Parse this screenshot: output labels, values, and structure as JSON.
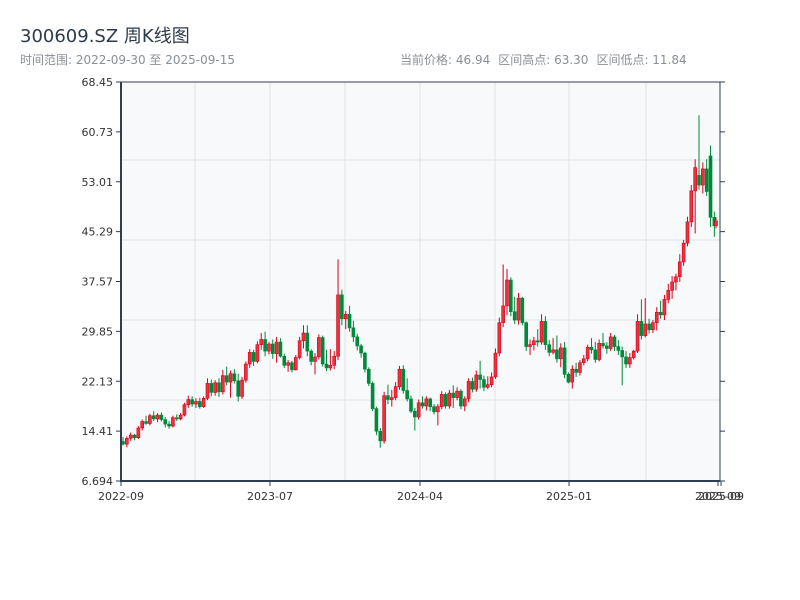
{
  "header": {
    "title": "300609.SZ 周K线图",
    "range_label": "时间范围: 2022-09-30 至 2025-09-15",
    "current_price": "当前价格: 46.94",
    "range_high": "区间高点: 63.30",
    "range_low": "区间低点: 11.84"
  },
  "colors": {
    "up": "#d9001b",
    "down": "#00893a",
    "axis": "#2c3e50",
    "grid": "#e1e5ea",
    "plot_bg": "#f7f9fb"
  },
  "chart_data": {
    "type": "candlestick",
    "title": "300609.SZ 周K线图",
    "ylim": [
      6.694,
      68.45
    ],
    "y_ticks": [
      "68.45",
      "60.73",
      "53.01",
      "45.29",
      "37.57",
      "29.85",
      "22.13",
      "14.41",
      "6.694"
    ],
    "x_ticks": [
      "2022-09",
      "2023-07",
      "2024-04",
      "2025-01",
      "2025-09",
      "2025-09"
    ],
    "x_range": [
      "2022-09-30",
      "2025-09-15"
    ],
    "grid": true,
    "up_color_meaning": "red = up, green = down",
    "columns": [
      "date",
      "open",
      "high",
      "low",
      "close"
    ],
    "candles": [
      [
        "2022-09-30",
        12.8,
        13.5,
        12.2,
        12.4
      ],
      [
        "2022-10-07",
        12.4,
        13.6,
        11.9,
        13.3
      ],
      [
        "2022-10-14",
        13.3,
        14.2,
        12.9,
        13.8
      ],
      [
        "2022-10-21",
        13.8,
        14.0,
        13.0,
        13.4
      ],
      [
        "2022-10-28",
        13.4,
        15.2,
        13.2,
        14.9
      ],
      [
        "2022-11-04",
        14.9,
        16.2,
        14.5,
        15.9
      ],
      [
        "2022-11-11",
        15.9,
        16.8,
        15.4,
        15.6
      ],
      [
        "2022-11-18",
        15.6,
        17.1,
        15.3,
        16.8
      ],
      [
        "2022-11-25",
        16.8,
        17.5,
        16.0,
        16.3
      ],
      [
        "2022-12-02",
        16.3,
        17.2,
        15.8,
        16.9
      ],
      [
        "2022-12-09",
        16.9,
        17.3,
        15.9,
        16.2
      ],
      [
        "2022-12-16",
        16.2,
        16.6,
        15.0,
        15.5
      ],
      [
        "2022-12-23",
        15.5,
        16.0,
        14.8,
        15.2
      ],
      [
        "2022-12-30",
        15.2,
        16.8,
        15.0,
        16.5
      ],
      [
        "2023-01-06",
        16.5,
        17.0,
        16.0,
        16.3
      ],
      [
        "2023-01-13",
        16.3,
        17.2,
        16.1,
        16.9
      ],
      [
        "2023-01-20",
        16.9,
        18.8,
        16.7,
        18.5
      ],
      [
        "2023-01-27",
        18.5,
        19.9,
        18.0,
        19.3
      ],
      [
        "2023-02-03",
        19.3,
        19.8,
        18.2,
        18.6
      ],
      [
        "2023-02-10",
        18.6,
        19.5,
        18.0,
        19.0
      ],
      [
        "2023-02-17",
        19.0,
        19.6,
        17.9,
        18.2
      ],
      [
        "2023-02-24",
        18.2,
        19.8,
        18.0,
        19.5
      ],
      [
        "2023-03-03",
        19.5,
        22.6,
        19.2,
        21.8
      ],
      [
        "2023-03-10",
        21.8,
        22.4,
        19.8,
        20.4
      ],
      [
        "2023-03-17",
        20.4,
        22.3,
        19.9,
        21.9
      ],
      [
        "2023-03-24",
        21.9,
        22.6,
        19.7,
        20.5
      ],
      [
        "2023-03-31",
        20.5,
        23.9,
        20.1,
        23.0
      ],
      [
        "2023-04-07",
        23.0,
        24.4,
        21.5,
        22.0
      ],
      [
        "2023-04-14",
        22.0,
        23.8,
        19.6,
        23.3
      ],
      [
        "2023-04-21",
        23.3,
        24.0,
        21.8,
        22.2
      ],
      [
        "2023-04-28",
        22.2,
        23.3,
        19.0,
        19.8
      ],
      [
        "2023-05-05",
        19.8,
        22.8,
        19.4,
        22.3
      ],
      [
        "2023-05-12",
        22.3,
        25.2,
        21.9,
        24.8
      ],
      [
        "2023-05-19",
        24.8,
        27.1,
        24.2,
        26.6
      ],
      [
        "2023-05-26",
        26.6,
        27.0,
        24.5,
        25.2
      ],
      [
        "2023-06-02",
        25.2,
        28.3,
        24.9,
        27.8
      ],
      [
        "2023-06-09",
        27.8,
        29.6,
        27.0,
        28.6
      ],
      [
        "2023-06-16",
        28.6,
        29.8,
        26.0,
        26.8
      ],
      [
        "2023-06-23",
        26.8,
        28.2,
        26.3,
        27.9
      ],
      [
        "2023-06-30",
        27.9,
        28.6,
        25.6,
        26.4
      ],
      [
        "2023-07-07",
        26.4,
        29.0,
        25.0,
        28.2
      ],
      [
        "2023-07-14",
        28.2,
        28.8,
        25.8,
        26.0
      ],
      [
        "2023-07-21",
        26.0,
        26.4,
        24.2,
        24.6
      ],
      [
        "2023-07-28",
        24.6,
        25.4,
        23.6,
        25.0
      ],
      [
        "2023-08-04",
        25.0,
        25.3,
        23.5,
        23.9
      ],
      [
        "2023-08-11",
        23.9,
        26.2,
        23.8,
        25.8
      ],
      [
        "2023-08-18",
        25.8,
        29.0,
        25.5,
        28.4
      ],
      [
        "2023-08-25",
        28.4,
        30.8,
        27.2,
        29.6
      ],
      [
        "2023-09-01",
        29.6,
        30.8,
        26.0,
        26.8
      ],
      [
        "2023-09-08",
        26.8,
        27.1,
        24.6,
        25.2
      ],
      [
        "2023-09-15",
        25.2,
        26.5,
        23.2,
        25.9
      ],
      [
        "2023-09-22",
        25.9,
        29.4,
        25.5,
        28.9
      ],
      [
        "2023-09-29",
        28.9,
        29.2,
        24.4,
        24.8
      ],
      [
        "2023-10-06",
        24.8,
        27.0,
        23.7,
        24.2
      ],
      [
        "2023-10-13",
        24.2,
        27.1,
        23.8,
        24.6
      ],
      [
        "2023-10-20",
        24.6,
        26.8,
        24.0,
        26.0
      ],
      [
        "2023-10-27",
        26.0,
        41.0,
        25.4,
        35.5
      ],
      [
        "2023-11-03",
        35.5,
        36.3,
        30.8,
        31.8
      ],
      [
        "2023-11-10",
        31.8,
        33.0,
        30.2,
        32.5
      ],
      [
        "2023-11-17",
        32.5,
        33.8,
        29.8,
        30.4
      ],
      [
        "2023-11-24",
        30.4,
        31.5,
        28.2,
        29.0
      ],
      [
        "2023-12-01",
        29.0,
        29.5,
        26.9,
        27.6
      ],
      [
        "2023-12-08",
        27.6,
        27.9,
        25.8,
        26.5
      ],
      [
        "2023-12-15",
        26.5,
        26.7,
        23.5,
        24.0
      ],
      [
        "2023-12-22",
        24.0,
        24.3,
        21.4,
        21.8
      ],
      [
        "2023-12-29",
        21.8,
        22.1,
        17.5,
        17.9
      ],
      [
        "2024-01-05",
        17.9,
        18.2,
        13.8,
        14.4
      ],
      [
        "2024-01-12",
        14.4,
        14.9,
        11.84,
        12.9
      ],
      [
        "2024-01-19",
        12.9,
        20.5,
        12.5,
        19.9
      ],
      [
        "2024-01-26",
        19.9,
        21.6,
        18.6,
        19.3
      ],
      [
        "2024-02-02",
        19.3,
        20.8,
        18.2,
        19.6
      ],
      [
        "2024-02-09",
        19.6,
        22.0,
        19.2,
        21.3
      ],
      [
        "2024-02-16",
        21.3,
        24.5,
        20.8,
        24.0
      ],
      [
        "2024-02-23",
        24.0,
        24.6,
        20.2,
        20.7
      ],
      [
        "2024-03-01",
        20.7,
        22.6,
        19.0,
        19.4
      ],
      [
        "2024-03-08",
        19.4,
        19.9,
        17.2,
        17.5
      ],
      [
        "2024-03-15",
        17.5,
        18.0,
        14.5,
        16.6
      ],
      [
        "2024-03-22",
        16.6,
        19.3,
        16.2,
        18.8
      ],
      [
        "2024-03-29",
        18.8,
        19.8,
        17.9,
        18.3
      ],
      [
        "2024-04-05",
        18.3,
        19.8,
        17.6,
        19.4
      ],
      [
        "2024-04-12",
        19.4,
        19.6,
        17.5,
        18.2
      ],
      [
        "2024-04-19",
        18.2,
        18.6,
        17.0,
        17.4
      ],
      [
        "2024-04-26",
        17.4,
        18.6,
        15.3,
        18.2
      ],
      [
        "2024-05-03",
        18.2,
        20.6,
        17.8,
        20.1
      ],
      [
        "2024-05-10",
        20.1,
        20.4,
        17.9,
        18.3
      ],
      [
        "2024-05-17",
        18.3,
        20.8,
        17.9,
        20.3
      ],
      [
        "2024-05-24",
        20.3,
        21.5,
        18.0,
        19.6
      ],
      [
        "2024-05-31",
        19.6,
        21.2,
        19.2,
        20.6
      ],
      [
        "2024-06-07",
        20.6,
        20.9,
        17.8,
        18.3
      ],
      [
        "2024-06-14",
        18.3,
        19.8,
        17.5,
        19.4
      ],
      [
        "2024-06-21",
        19.4,
        22.6,
        18.9,
        22.1
      ],
      [
        "2024-06-28",
        22.1,
        22.7,
        20.4,
        20.9
      ],
      [
        "2024-07-05",
        20.9,
        23.8,
        20.5,
        23.1
      ],
      [
        "2024-07-12",
        23.1,
        25.3,
        21.0,
        22.4
      ],
      [
        "2024-07-19",
        22.4,
        23.0,
        20.6,
        21.2
      ],
      [
        "2024-07-26",
        21.2,
        22.9,
        20.9,
        21.6
      ],
      [
        "2024-08-02",
        21.6,
        23.5,
        21.2,
        22.8
      ],
      [
        "2024-08-09",
        22.8,
        27.2,
        22.5,
        26.5
      ],
      [
        "2024-08-16",
        26.5,
        32.0,
        26.0,
        31.2
      ],
      [
        "2024-08-23",
        31.2,
        40.2,
        30.5,
        33.8
      ],
      [
        "2024-08-30",
        33.8,
        39.5,
        32.4,
        37.8
      ],
      [
        "2024-09-06",
        37.8,
        38.2,
        32.2,
        32.9
      ],
      [
        "2024-09-13",
        32.9,
        35.2,
        31.0,
        31.6
      ],
      [
        "2024-09-20",
        31.6,
        35.8,
        30.9,
        35.0
      ],
      [
        "2024-09-27",
        35.0,
        35.2,
        30.8,
        31.2
      ],
      [
        "2024-10-04",
        31.2,
        31.4,
        26.8,
        27.5
      ],
      [
        "2024-10-11",
        27.5,
        28.6,
        26.2,
        27.8
      ],
      [
        "2024-10-18",
        27.8,
        29.0,
        26.9,
        28.4
      ],
      [
        "2024-10-25",
        28.4,
        30.2,
        27.5,
        28.2
      ],
      [
        "2024-11-01",
        28.2,
        32.5,
        27.8,
        31.4
      ],
      [
        "2024-11-08",
        31.4,
        32.2,
        27.0,
        27.8
      ],
      [
        "2024-11-15",
        27.8,
        28.5,
        26.0,
        26.6
      ],
      [
        "2024-11-22",
        26.6,
        28.8,
        26.3,
        27.0
      ],
      [
        "2024-11-29",
        27.0,
        29.2,
        25.0,
        25.6
      ],
      [
        "2024-12-06",
        25.6,
        28.0,
        24.3,
        27.3
      ],
      [
        "2024-12-13",
        27.3,
        28.2,
        22.6,
        23.2
      ],
      [
        "2024-12-20",
        23.2,
        23.5,
        21.8,
        22.0
      ],
      [
        "2024-12-27",
        22.0,
        24.6,
        21.0,
        24.0
      ],
      [
        "2025-01-03",
        24.0,
        25.0,
        22.8,
        23.5
      ],
      [
        "2025-01-10",
        23.5,
        25.4,
        23.0,
        25.0
      ],
      [
        "2025-01-17",
        25.0,
        26.2,
        24.6,
        25.6
      ],
      [
        "2025-01-24",
        25.6,
        27.8,
        25.2,
        27.4
      ],
      [
        "2025-01-31",
        27.4,
        28.8,
        26.4,
        27.0
      ],
      [
        "2025-02-07",
        27.0,
        28.2,
        25.0,
        25.5
      ],
      [
        "2025-02-14",
        25.5,
        28.6,
        25.2,
        28.0
      ],
      [
        "2025-02-21",
        28.0,
        29.6,
        27.2,
        27.6
      ],
      [
        "2025-02-28",
        27.6,
        28.2,
        26.4,
        27.2
      ],
      [
        "2025-03-07",
        27.2,
        29.6,
        26.8,
        29.0
      ],
      [
        "2025-03-14",
        29.0,
        29.3,
        26.8,
        27.5
      ],
      [
        "2025-03-21",
        27.5,
        28.5,
        26.2,
        26.9
      ],
      [
        "2025-03-28",
        26.9,
        27.5,
        21.5,
        25.9
      ],
      [
        "2025-04-04",
        25.9,
        26.8,
        24.2,
        24.8
      ],
      [
        "2025-04-11",
        24.8,
        26.5,
        24.2,
        25.8
      ],
      [
        "2025-04-18",
        25.8,
        27.0,
        25.5,
        26.8
      ],
      [
        "2025-04-25",
        26.8,
        32.5,
        26.5,
        31.4
      ],
      [
        "2025-05-02",
        31.4,
        34.8,
        28.6,
        29.2
      ],
      [
        "2025-05-09",
        29.2,
        35.0,
        28.9,
        31.0
      ],
      [
        "2025-05-16",
        31.0,
        31.8,
        29.5,
        30.1
      ],
      [
        "2025-05-23",
        30.1,
        31.6,
        29.6,
        31.2
      ],
      [
        "2025-05-30",
        31.2,
        33.6,
        30.0,
        32.8
      ],
      [
        "2025-06-06",
        32.8,
        34.6,
        31.8,
        32.4
      ],
      [
        "2025-06-13",
        32.4,
        35.5,
        31.6,
        34.8
      ],
      [
        "2025-06-20",
        34.8,
        37.2,
        34.2,
        36.2
      ],
      [
        "2025-06-27",
        36.2,
        38.4,
        34.9,
        37.5
      ],
      [
        "2025-07-04",
        37.5,
        38.8,
        36.2,
        38.3
      ],
      [
        "2025-07-11",
        38.3,
        41.8,
        37.5,
        40.6
      ],
      [
        "2025-07-18",
        40.6,
        44.0,
        40.0,
        43.5
      ],
      [
        "2025-07-25",
        43.5,
        47.6,
        43.0,
        46.8
      ],
      [
        "2025-08-01",
        46.8,
        52.5,
        46.0,
        51.6
      ],
      [
        "2025-08-08",
        51.6,
        56.5,
        45.0,
        55.2
      ],
      [
        "2025-08-15",
        54.0,
        63.3,
        51.8,
        52.5
      ],
      [
        "2025-08-22",
        52.5,
        56.0,
        51.2,
        55.0
      ],
      [
        "2025-08-29",
        55.0,
        56.5,
        50.8,
        51.5
      ],
      [
        "2025-09-05",
        57.0,
        58.6,
        46.0,
        47.5
      ],
      [
        "2025-09-12",
        47.5,
        48.4,
        44.5,
        46.2
      ],
      [
        "2025-09-15",
        46.2,
        47.5,
        45.8,
        46.94
      ]
    ]
  }
}
